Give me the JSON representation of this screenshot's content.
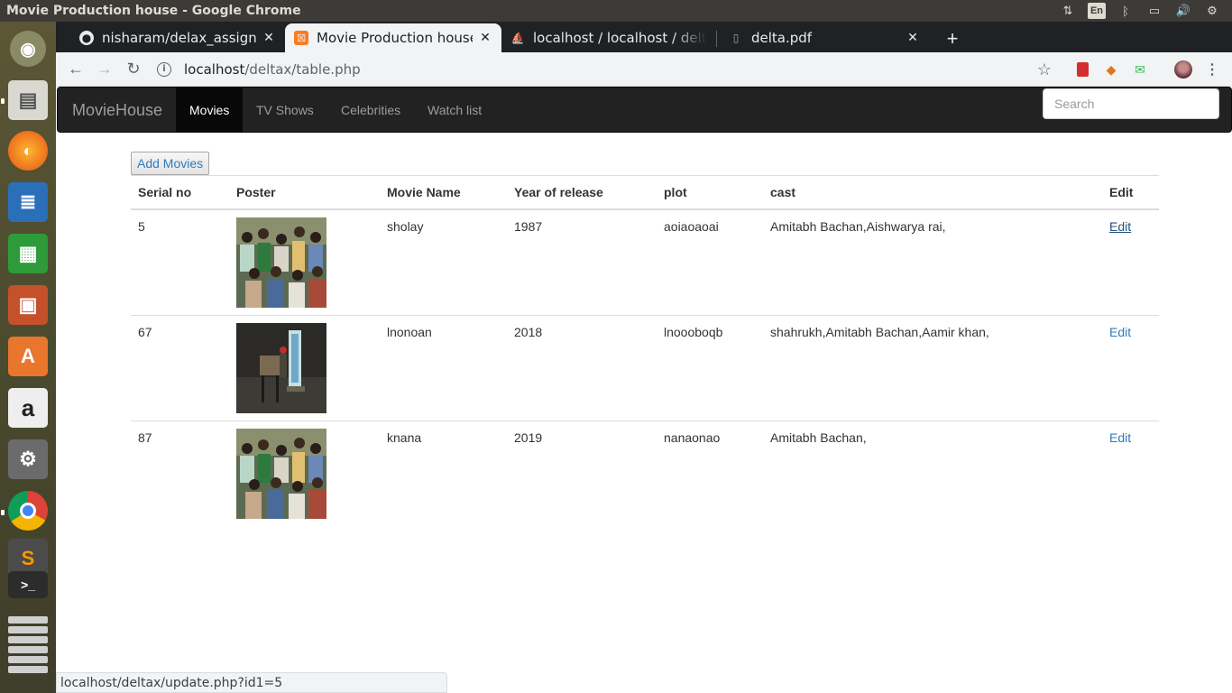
{
  "system": {
    "window_title": "Movie Production house - Google Chrome",
    "lang": "En"
  },
  "browser": {
    "tabs": [
      {
        "label": "nisharam/delax_assignme",
        "icon": "github-icon"
      },
      {
        "label": "Movie Production house",
        "icon": "xampp-icon"
      },
      {
        "label": "localhost / localhost / delt",
        "icon": "phpmyadmin-icon"
      },
      {
        "label": "delta.pdf",
        "icon": "file-icon"
      }
    ],
    "url_host": "localhost",
    "url_path": "/deltax/table.php",
    "status_url": "localhost/deltax/update.php?id1=5"
  },
  "navbar": {
    "brand": "MovieHouse",
    "links": [
      "Movies",
      "TV Shows",
      "Celebrities",
      "Watch list"
    ],
    "search_placeholder": "Search"
  },
  "main": {
    "add_label": "Add Movies",
    "columns": [
      "Serial no",
      "Poster",
      "Movie Name",
      "Year of release",
      "plot",
      "cast",
      "Edit"
    ],
    "rows": [
      {
        "serial": "5",
        "poster": "crowd-photo",
        "name": "sholay",
        "year": "1987",
        "plot": "aoiaoaoai",
        "cast": "Amitabh Bachan,Aishwarya rai,",
        "edit": "Edit"
      },
      {
        "serial": "67",
        "poster": "dark-room-photo",
        "name": "lnonoan",
        "year": "2018",
        "plot": "lnoooboqb",
        "cast": "shahrukh,Amitabh Bachan,Aamir khan,",
        "edit": "Edit"
      },
      {
        "serial": "87",
        "poster": "crowd-photo",
        "name": "knana",
        "year": "2019",
        "plot": "nanaonao",
        "cast": "Amitabh Bachan,",
        "edit": "Edit"
      }
    ]
  },
  "colors": {
    "navbar_bg": "#222222",
    "link": "#337ab7",
    "chrome_dark": "#202124"
  }
}
